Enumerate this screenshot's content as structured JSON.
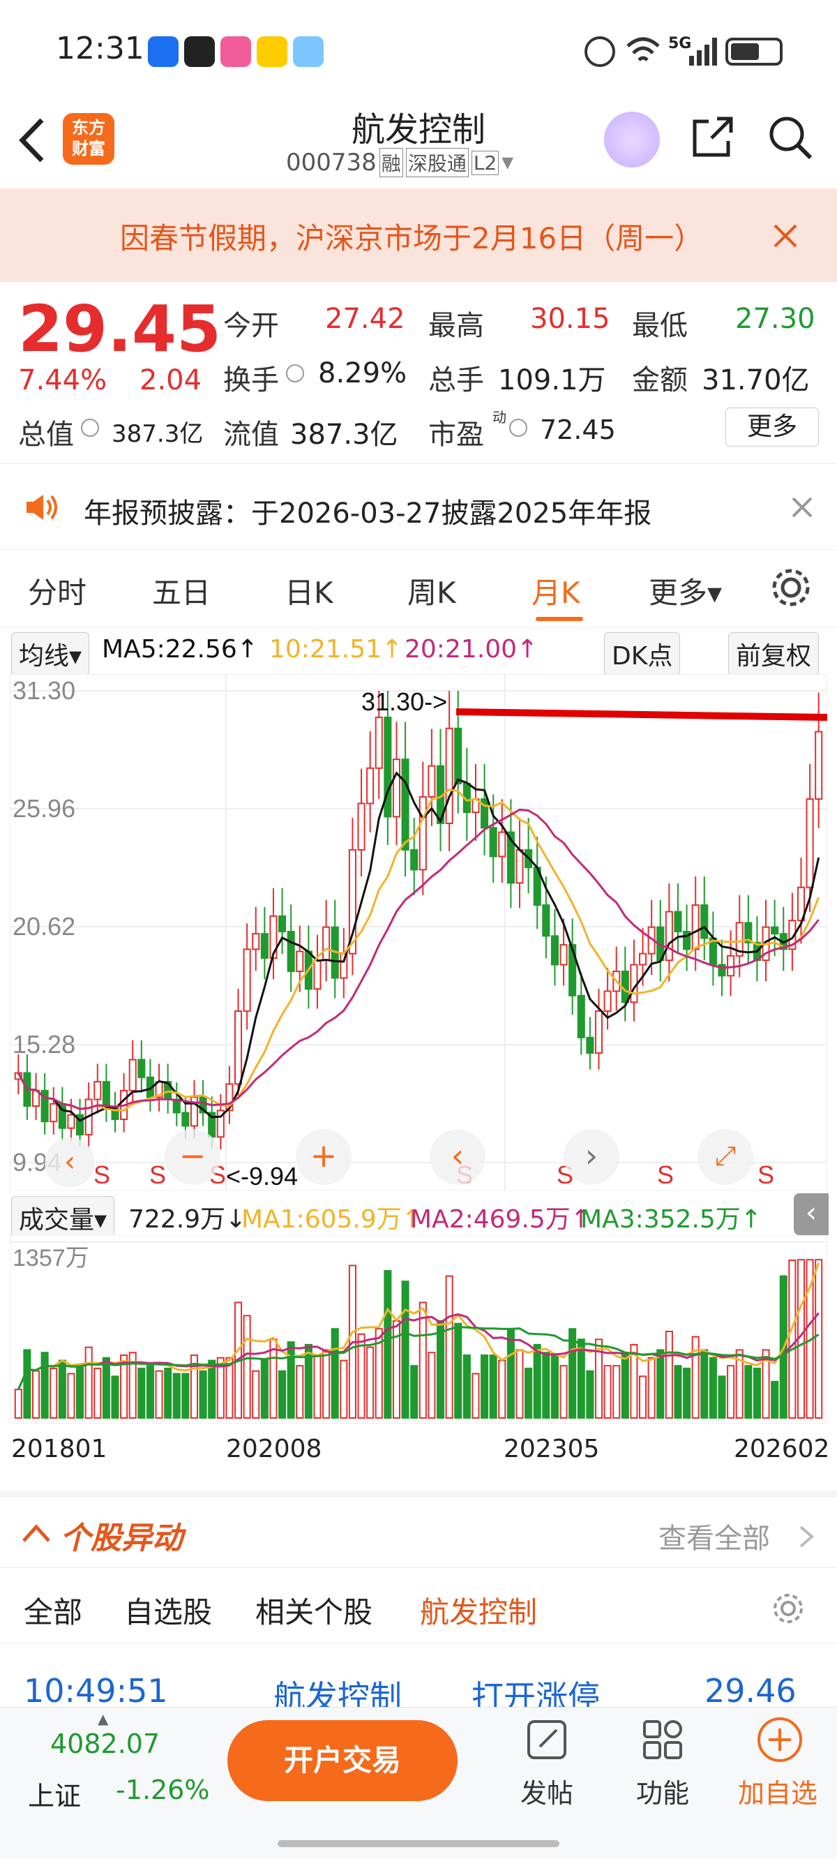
{
  "status_bar": {
    "time": "12:31",
    "signal": "5G",
    "battery": "58"
  },
  "header": {
    "app_logo": "东方\n财富",
    "stock_name": "航发控制",
    "stock_code": "000738",
    "badges": [
      "融",
      "深股通",
      "L2"
    ]
  },
  "notice": {
    "text": "因春节假期，沪深京市场于2月16日（周一）"
  },
  "quote": {
    "price": "29.45",
    "change_pct": "7.44%",
    "change": "2.04",
    "open_label": "今开",
    "open": "27.42",
    "high_label": "最高",
    "high": "30.15",
    "low_label": "最低",
    "low": "27.30",
    "turnover_label": "换手",
    "turnover": "8.29%",
    "volume_label": "总手",
    "volume": "109.1万",
    "amount_label": "金额",
    "amount": "31.70亿",
    "mktcap_label": "总值",
    "mktcap": "387.3亿",
    "float_label": "流值",
    "float_cap": "387.3亿",
    "pe_label": "市盈",
    "pe_sup": "动",
    "pe": "72.45",
    "more_label": "更多"
  },
  "announcement": {
    "text": "年报预披露：于2026-03-27披露2025年年报"
  },
  "tabs": {
    "items": [
      "分时",
      "五日",
      "日K",
      "周K",
      "月K",
      "更多▾"
    ],
    "active": "月K"
  },
  "ma_bar": {
    "type_label": "均线▾",
    "ma5": "MA5:22.56↑",
    "ma10": "10:21.51↑",
    "ma20": "20:21.00↑",
    "dk_label": "DK点",
    "adjust_label": "前复权"
  },
  "kline": {
    "y_ticks": [
      "31.30",
      "25.96",
      "20.62",
      "15.28",
      "9.94"
    ],
    "max_annotation": "31.30->",
    "min_annotation": "<-9.94",
    "signal_label": "S"
  },
  "volume_bar": {
    "type_label": "成交量▾",
    "vol": "722.9万↓",
    "ma1": "MA1:605.9万↑",
    "ma2": "MA2:469.5万↑",
    "ma3": "MA3:352.5万↑",
    "max_label": "1357万",
    "x_ticks": [
      "201801",
      "202008",
      "202305",
      "202602"
    ]
  },
  "movement": {
    "title": "个股异动",
    "view_all": "查看全部",
    "filters": [
      "全部",
      "自选股",
      "相关个股",
      "航发控制"
    ],
    "row": {
      "time": "10:49:51",
      "name": "航发控制",
      "event": "打开涨停",
      "price": "29.46"
    }
  },
  "bottom": {
    "index_value": "4082.07",
    "index_name": "上证",
    "index_change": "-1.26%",
    "trade_button": "开户交易",
    "post_label": "发帖",
    "func_label": "功能",
    "add_label": "加自选"
  },
  "colors": {
    "up": "#e52d2d",
    "down": "#1f9a2f",
    "accent": "#f56a1b",
    "ma5": "#111111",
    "ma10": "#f0b429",
    "ma20": "#c4287a"
  },
  "chart_data": {
    "type": "candlestick",
    "title": "",
    "ylim": [
      9.94,
      31.3
    ],
    "x_ticks": [
      "201801",
      "202008",
      "202305",
      "202602"
    ],
    "series_close": [
      14,
      12.5,
      13.2,
      11.8,
      12.6,
      11.5,
      12.1,
      11.2,
      12.8,
      13.6,
      12.4,
      11.9,
      13.2,
      14.6,
      13.8,
      12.9,
      13.6,
      12.8,
      12.2,
      11.6,
      12.9,
      12.2,
      11.1,
      12.3,
      13.5,
      16.8,
      19.6,
      20.3,
      19.2,
      21.1,
      20.4,
      18.6,
      19.5,
      17.8,
      19.1,
      20.6,
      18.3,
      19.4,
      24.1,
      26.2,
      27.8,
      30.1,
      25.6,
      28.2,
      24.1,
      23.2,
      26.5,
      27.9,
      25.3,
      29.6,
      27.1,
      25.8,
      26.4,
      25.1,
      23.8,
      24.9,
      22.6,
      24.1,
      23.3,
      21.6,
      20.2,
      18.9,
      19.8,
      17.5,
      15.6,
      14.9,
      16.8,
      17.7,
      18.6,
      17.2,
      18.9,
      19.4,
      20.6,
      19.1,
      21.3,
      20.4,
      19.6,
      21.6,
      20.1,
      18.9,
      18.4,
      19.3,
      20.8,
      19.9,
      19.1,
      20.6,
      20.3,
      19.6,
      20.9,
      22.4,
      26.4,
      29.45
    ],
    "ma5_last": 22.56,
    "ma10_last": 21.51,
    "ma20_last": 21.0,
    "volume_last": "722.9万",
    "volume_max": "1357万"
  }
}
